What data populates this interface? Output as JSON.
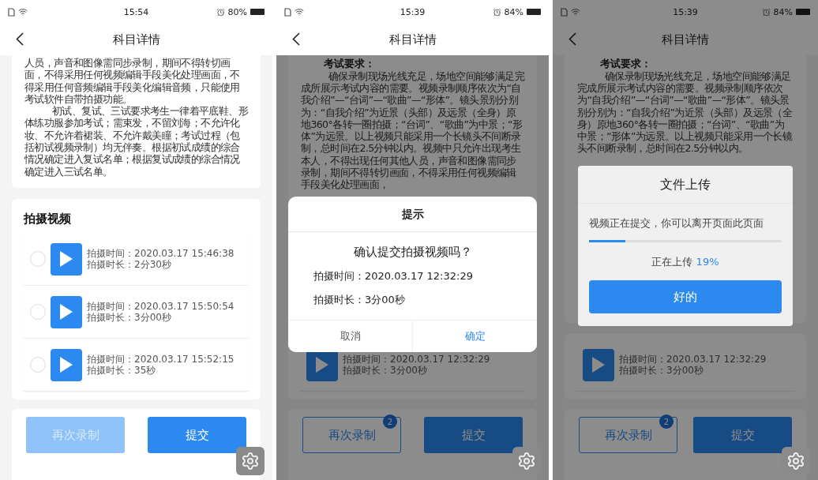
{
  "screens": [
    {
      "status_bar": {
        "time": "15:54",
        "battery": "80%"
      },
      "header": {
        "title": "科目详情"
      },
      "content": {
        "paragraphs": [
          {
            "indent": false,
            "text": "人员，声音和图像需同步录制，期间不得转切画面，不得采用任何视频编辑手段美化处理画面，不得采用任何音频编辑手段美化编辑音频，只能使用考试软件自带拍摄功能。"
          },
          {
            "indent": true,
            "text": "初试、复试、三试要求考生一律着平底鞋、形体练功服参加考试；需束发，不留刘海；不允许化妆、不允许着裙装、不允许戴美瞳；考试过程（包括初试视频录制）均无伴奏。根据初试成绩的综合情况确定进入复试名单；根据复试成绩的综合情况确定进入三试名单。"
          }
        ]
      },
      "videos": {
        "title": "拍摄视频",
        "selectable": true,
        "items": [
          {
            "time": "拍摄时间：2020.03.17 15:46:38",
            "duration": "拍摄时长：2分30秒",
            "selected": false
          },
          {
            "time": "拍摄时间：2020.03.17 15:50:54",
            "duration": "拍摄时长：3分00秒",
            "selected": false
          },
          {
            "time": "拍摄时间：2020.03.17 15:52:15",
            "duration": "拍摄时长：35秒",
            "selected": false
          }
        ]
      },
      "actions": {
        "retake": {
          "label": "再次录制",
          "disabled": true
        },
        "submit": {
          "label": "提交"
        }
      }
    },
    {
      "status_bar": {
        "time": "15:39",
        "battery": "84%"
      },
      "header": {
        "title": "科目详情"
      },
      "content": {
        "heading": "考试要求：",
        "paragraphs": [
          {
            "indent": true,
            "text": "确保录制现场光线充足，场地空间能够满足完成所展示考试内容的需要。视频录制顺序依次为“自我介绍”—“台词”—“歌曲”—“形体”。镜头景别分别为：“自我介绍”为近景（头部）及远景（全身）原地360°各转一圈拍摄；“台词”、“歌曲”为中景；“形体”为远景。以上视频只能采用一个长镜头不间断录制，总时间在2.5分钟以内。视频中只允许出现考生本人，不得出现任何其他人员，声音和图像需同步录制，期间不得转切画面，不得采用任何视频编辑手段美化处理画面，"
          }
        ]
      },
      "videos": {
        "selectable": false,
        "items": [
          {
            "time": "拍摄时间：2020.03.17 12:32:29",
            "duration": "拍摄时长：3分00秒"
          }
        ]
      },
      "actions": {
        "retake": {
          "label": "再次录制",
          "disabled": false,
          "badge": "2"
        },
        "submit": {
          "label": "提交"
        }
      },
      "dialog": {
        "kind": "confirm",
        "title": "提示",
        "message": "确认提交拍摄视频吗？",
        "lines": [
          "拍摄时间：2020.03.17 12:32:29",
          "拍摄时长：3分00秒"
        ],
        "cancel": "取消",
        "ok": "确定"
      }
    },
    {
      "status_bar": {
        "time": "15:39",
        "battery": "84%"
      },
      "header": {
        "title": "科目详情"
      },
      "content": {
        "heading": "考试要求：",
        "paragraphs": [
          {
            "indent": true,
            "text": "确保录制现场光线充足，场地空间能够满足完成所展示考试内容的需要。视频录制顺序依次为“自我介绍”—“台词”—“歌曲”—“形体”。镜头景别分别为：“自我介绍”为近景（头部）及远景（全身）原地360°各转一圈拍摄；“台词”、“歌曲”为中景；“形体”为远景。以上视频只能采用一个长镜头不间断录制，总时间在2.5分钟以内。"
          }
        ]
      },
      "videos": {
        "selectable": false,
        "items": [
          {
            "time": "拍摄时间：2020.03.17 12:32:29",
            "duration": "拍摄时长：3分00秒"
          }
        ]
      },
      "actions": {
        "retake": {
          "label": "再次录制",
          "disabled": false,
          "badge": "2"
        },
        "submit": {
          "label": "提交"
        }
      },
      "dialog": {
        "kind": "progress",
        "title": "文件上传",
        "message": "视频正在提交，你可以离开页面此页面",
        "level": 0.19,
        "status": "正在上传",
        "percent": "19%",
        "button": "好的"
      }
    }
  ]
}
